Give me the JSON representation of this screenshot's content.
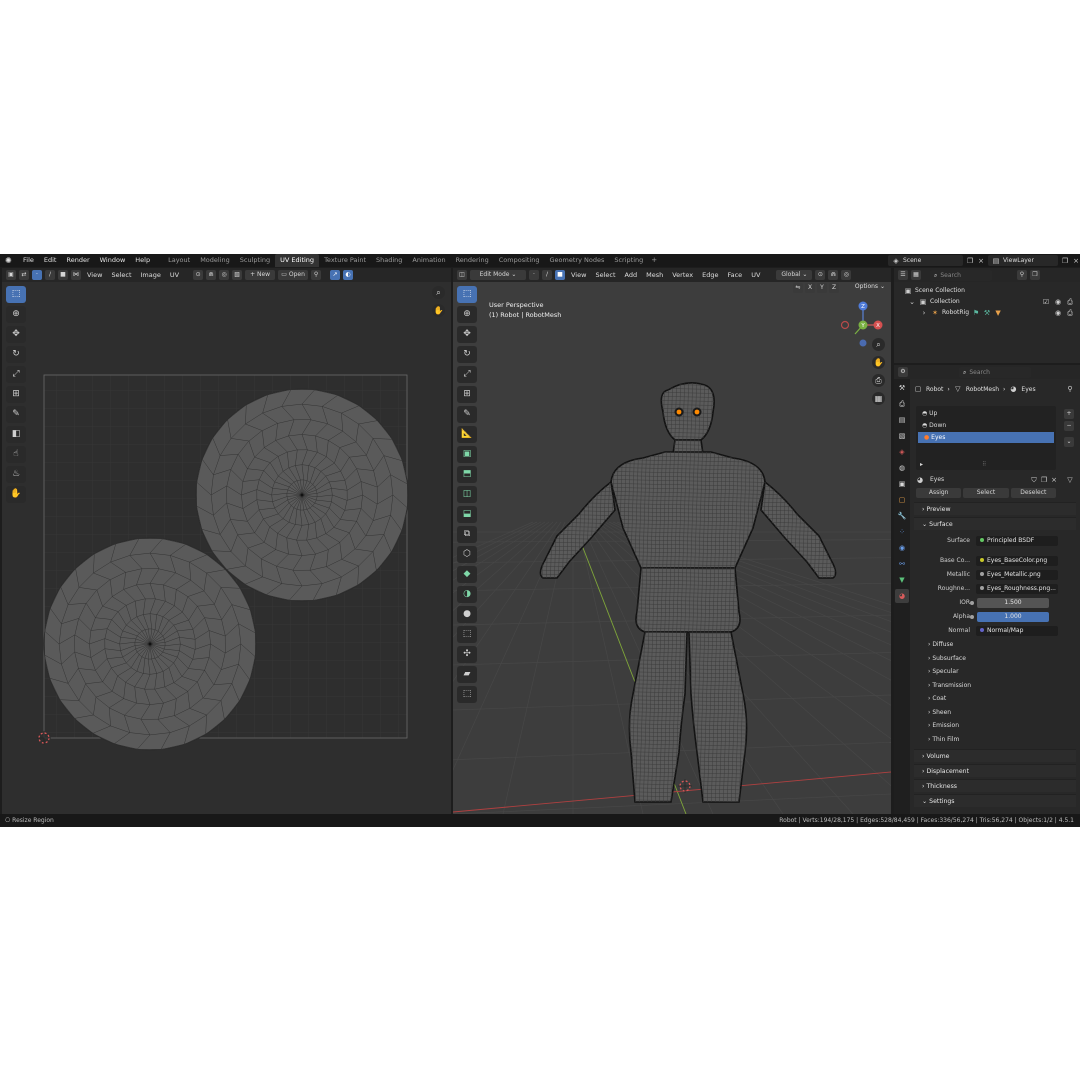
{
  "topbar": {
    "menus": [
      "File",
      "Edit",
      "Render",
      "Window",
      "Help"
    ],
    "workspaces": [
      "Layout",
      "Modeling",
      "Sculpting",
      "UV Editing",
      "Texture Paint",
      "Shading",
      "Animation",
      "Rendering",
      "Compositing",
      "Geometry Nodes",
      "Scripting"
    ],
    "active_workspace": "UV Editing",
    "scene": "Scene",
    "view_layer": "ViewLayer"
  },
  "uv_editor": {
    "menus": [
      "View",
      "Select",
      "Image",
      "UV"
    ],
    "new_label": "New",
    "open_label": "Open"
  },
  "viewport": {
    "mode": "Edit Mode",
    "menus": [
      "View",
      "Select",
      "Add",
      "Mesh",
      "Vertex",
      "Edge",
      "Face",
      "UV"
    ],
    "orientation": "Global",
    "options_label": "Options",
    "axis_x": "X",
    "axis_y": "Y",
    "axis_z": "Z",
    "info_line1": "User Perspective",
    "info_line2": "(1) Robot | RobotMesh"
  },
  "outliner": {
    "search_placeholder": "Search",
    "scene_collection": "Scene Collection",
    "collection": "Collection",
    "object": "RobotRig"
  },
  "properties": {
    "search_placeholder": "Search",
    "breadcrumb": [
      "Robot",
      "RobotMesh",
      "Eyes"
    ],
    "slots": [
      "Up",
      "Down",
      "Eyes"
    ],
    "selected_slot": "Eyes",
    "material_name": "Eyes",
    "assign_label": "Assign",
    "select_label": "Select",
    "deselect_label": "Deselect",
    "preview_label": "Preview",
    "surface_label": "Surface",
    "surface_row_label": "Surface",
    "surface_value": "Principled BSDF",
    "inputs": [
      {
        "label": "Base Co...",
        "value": "Eyes_BaseColor.png"
      },
      {
        "label": "Metallic",
        "value": "Eyes_Metallic.png"
      },
      {
        "label": "Roughne...",
        "value": "Eyes_Roughness.png..."
      },
      {
        "label": "IOR",
        "value": "1.500"
      },
      {
        "label": "Alpha",
        "value": "1.000"
      },
      {
        "label": "Normal",
        "value": "Normal/Map"
      }
    ],
    "subpanels": [
      "Diffuse",
      "Subsurface",
      "Specular",
      "Transmission",
      "Coat",
      "Sheen",
      "Emission",
      "Thin Film"
    ],
    "panels": [
      "Volume",
      "Displacement",
      "Thickness",
      "Settings"
    ]
  },
  "statusbar": {
    "left": "Resize Region",
    "right": "Robot | Verts:194/28,175 | Edges:528/84,459 | Faces:336/56,274 | Tris:56,274 | Objects:1/2 | 4.5.1"
  },
  "colors": {
    "accent": "#4772b3",
    "socket_yellow": "#c7c729",
    "socket_gray": "#a1a1a1",
    "socket_blue": "#6363c7",
    "socket_green": "#63c763",
    "eye_glow": "#ff8a00"
  }
}
